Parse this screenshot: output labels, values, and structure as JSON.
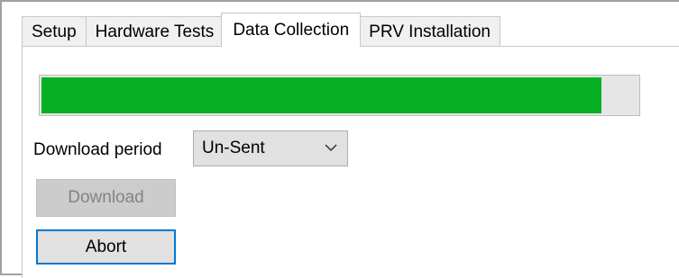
{
  "tabs": [
    {
      "label": "Setup",
      "active": false
    },
    {
      "label": "Hardware Tests",
      "active": false
    },
    {
      "label": "Data Collection",
      "active": true
    },
    {
      "label": "PRV Installation",
      "active": false
    }
  ],
  "progress": {
    "value_percent": 94,
    "fill_color": "#06b025"
  },
  "download_period": {
    "label": "Download period",
    "selected": "Un-Sent",
    "icon": "chevron-down-icon"
  },
  "buttons": {
    "download_label": "Download",
    "download_enabled": false,
    "abort_label": "Abort"
  },
  "colors": {
    "focus_border": "#0078d7",
    "progress_green": "#06b025"
  }
}
